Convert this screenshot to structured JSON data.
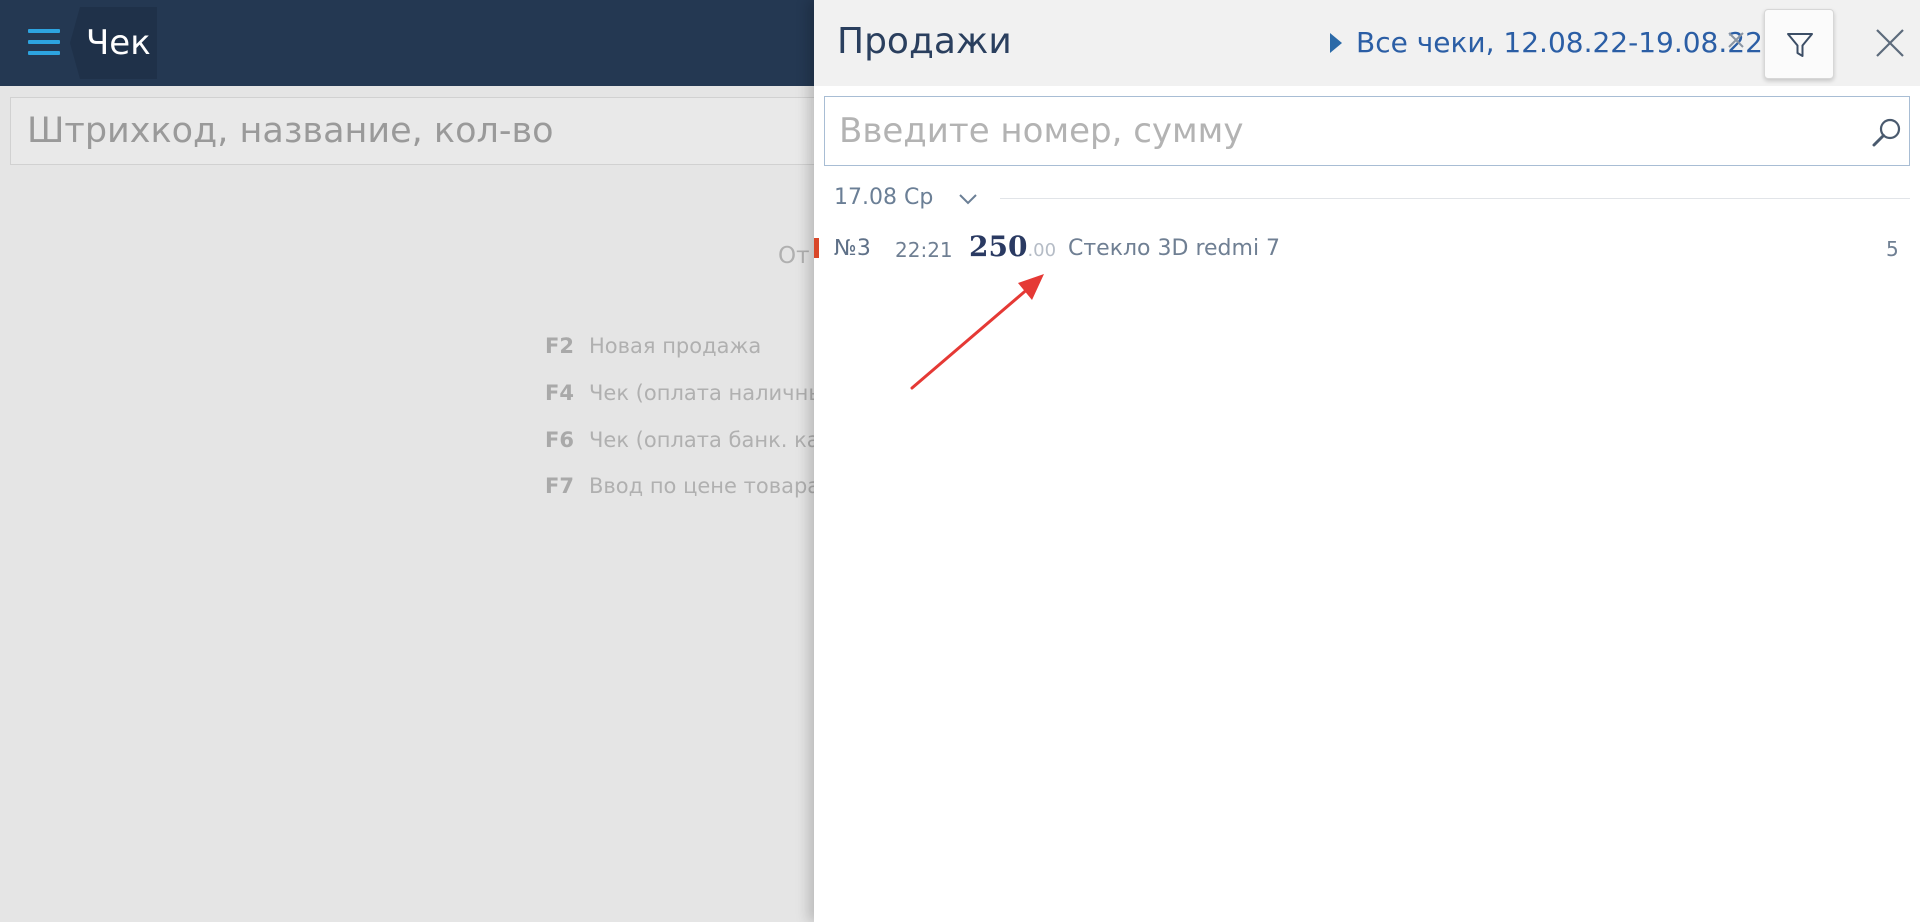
{
  "app": {
    "title": "Чек",
    "barcode_placeholder": "Штрихкод, название, кол-во",
    "partial_text": "От",
    "hotkeys": [
      {
        "key": "F2",
        "label": "Новая продажа"
      },
      {
        "key": "F4",
        "label": "Чек (оплата наличными"
      },
      {
        "key": "F6",
        "label": "Чек (оплата банк. карт"
      },
      {
        "key": "F7",
        "label": "Ввод по цене товара"
      }
    ]
  },
  "sales_panel": {
    "title": "Продажи",
    "filter_summary": "Все чеки, 12.08.22-19.08.22",
    "search_placeholder": "Введите номер, сумму",
    "groups": [
      {
        "date_label": "17.08 Ср",
        "receipts": [
          {
            "number": "№3",
            "time": "22:21",
            "amount_int": "250",
            "amount_frac": ".00",
            "description": "Стекло 3D redmi 7",
            "count": "5"
          }
        ]
      }
    ]
  },
  "colors": {
    "topbar": "#243852",
    "accent_blue": "#2da4e0",
    "link_blue": "#2b5ea5",
    "marker_red": "#d9482a",
    "annotation_arrow": "#e53935"
  },
  "icons": {
    "menu": "hamburger-icon",
    "filter": "funnel-icon",
    "close": "close-icon",
    "clear": "clear-filter-icon",
    "search": "magnifier-icon",
    "expand": "chevron-down-icon"
  }
}
